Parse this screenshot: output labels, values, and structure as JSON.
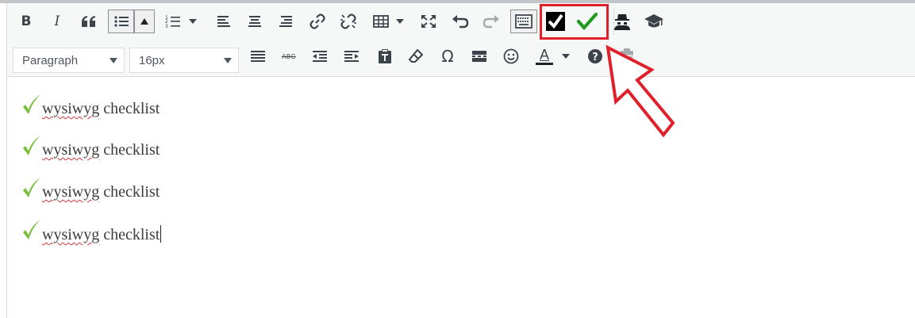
{
  "editor": {
    "format_select": "Paragraph",
    "fontsize_select": "16px",
    "bold_label": "B",
    "italic_label": "I",
    "color_label": "A",
    "omega_label": "Ω",
    "strike_label": "ABC",
    "paragraphs": [
      {
        "word": "wysiwyg",
        "rest": " checklist"
      },
      {
        "word": "wysiwyg",
        "rest": " checklist"
      },
      {
        "word": "wysiwyg",
        "rest": " checklist"
      },
      {
        "word": "wysiwyg",
        "rest": " checklist"
      }
    ],
    "colors": {
      "check_green": "#79bf3a",
      "checkbox_green": "#1f9a1f",
      "highlight_red": "#e0202a"
    }
  }
}
